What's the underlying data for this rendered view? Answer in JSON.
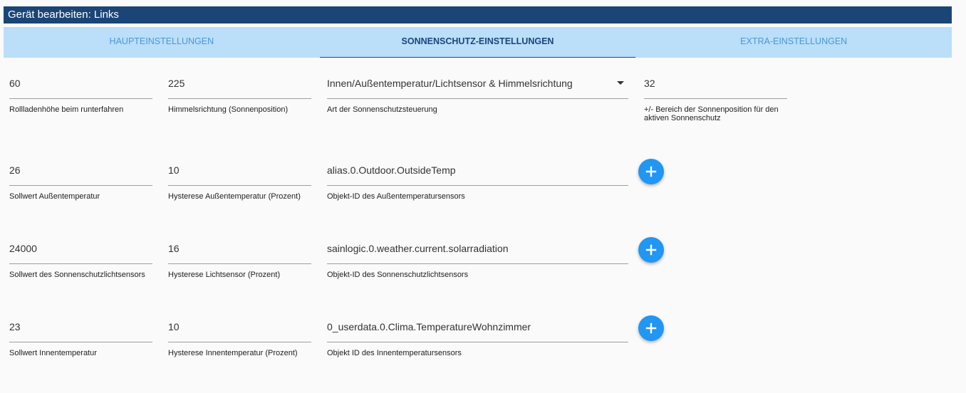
{
  "window": {
    "title": "Gerät bearbeiten: Links"
  },
  "tabs": [
    {
      "label": "HAUPTEINSTELLUNGEN"
    },
    {
      "label": "SONNENSCHUTZ-EINSTELLUNGEN"
    },
    {
      "label": "EXTRA-EINSTELLUNGEN"
    }
  ],
  "rows": [
    {
      "fields": [
        {
          "value": "60",
          "label": "Rollladenhöhe beim runterfahren"
        },
        {
          "value": "225",
          "label": "Himmelsrichtung (Sonnenposition)"
        },
        {
          "value": "Innen/Außentemperatur/Lichtsensor & Himmelsrichtung",
          "label": "Art der Sonnenschutzsteuerung"
        },
        {
          "value": "32",
          "label": "+/- Bereich der Sonnenposition für den aktiven Sonnenschutz"
        }
      ]
    },
    {
      "fields": [
        {
          "value": "26",
          "label": "Sollwert Außentemperatur"
        },
        {
          "value": "10",
          "label": "Hysterese Außentemperatur (Prozent)"
        },
        {
          "value": "alias.0.Outdoor.OutsideTemp",
          "label": "Objekt-ID des Außentemperatursensors"
        }
      ]
    },
    {
      "fields": [
        {
          "value": "24000",
          "label": "Sollwert des Sonnenschutzlichtsensors"
        },
        {
          "value": "16",
          "label": "Hysterese Lichtsensor (Prozent)"
        },
        {
          "value": "sainlogic.0.weather.current.solarradiation",
          "label": "Objekt-ID des Sonnenschutzlichtsensors"
        }
      ]
    },
    {
      "fields": [
        {
          "value": "23",
          "label": "Sollwert Innentemperatur"
        },
        {
          "value": "10",
          "label": "Hysterese Innentemperatur (Prozent)"
        },
        {
          "value": "0_userdata.0.Clima.TemperatureWohnzimmer",
          "label": "Objekt ID des Innentemperatursensors"
        }
      ]
    }
  ],
  "colors": {
    "titlebar": "#1a4576",
    "tabs_bg": "#bbdef9",
    "active_tab": "#19457a",
    "inactive_tab": "#4a97d6",
    "accent": "#2196f3"
  },
  "icons": {
    "add": "plus-icon",
    "dropdown": "arrow-drop-down-icon"
  }
}
